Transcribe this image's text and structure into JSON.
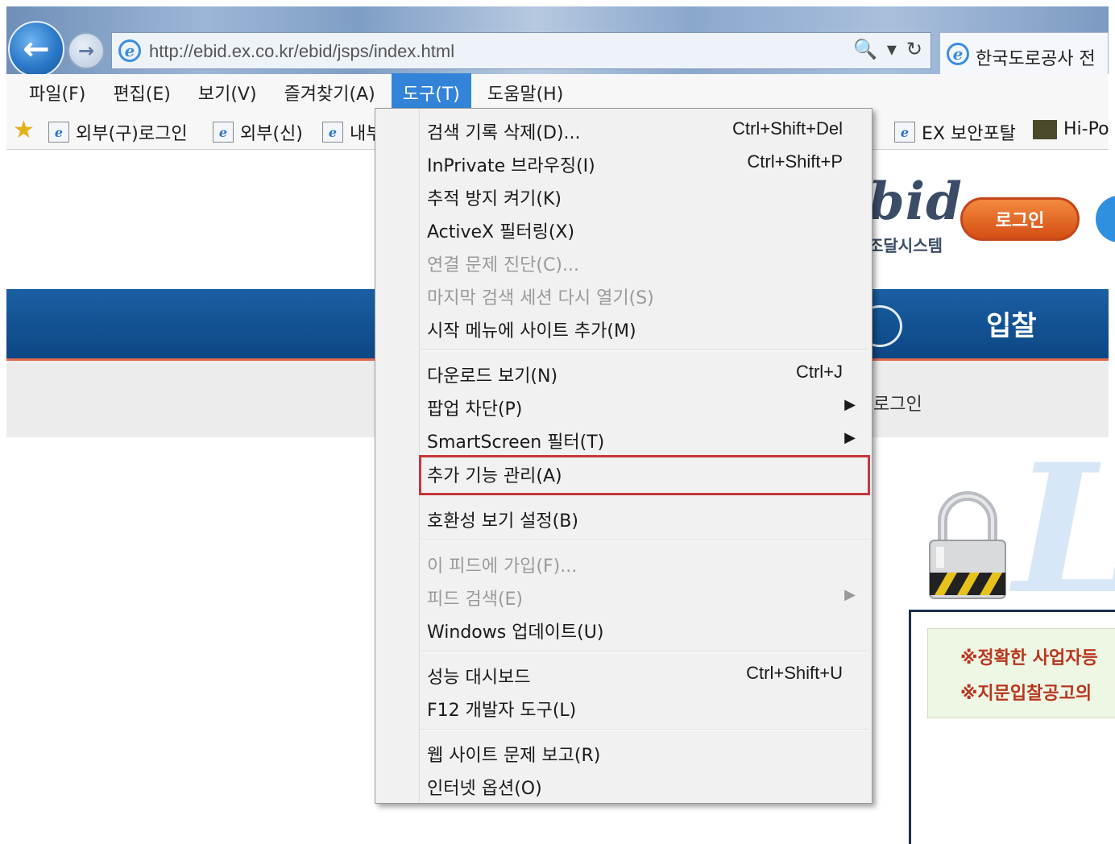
{
  "browser": {
    "url": "http://ebid.ex.co.kr/ebid/jsps/index.html",
    "tab_title": "한국도로공사 전",
    "addr_search_icon": "🔍",
    "addr_dropdown_icon": "▾",
    "addr_refresh_icon": "↻"
  },
  "menubar": {
    "items": [
      "파일(F)",
      "편집(E)",
      "보기(V)",
      "즐겨찾기(A)",
      "도구(T)",
      "도움말(H)"
    ],
    "active": "도구(T)"
  },
  "favorites": {
    "items": [
      "외부(구)로그인",
      "외부(신)",
      "내부",
      "EX 보안포탈",
      "Hi-Po"
    ]
  },
  "page": {
    "logo_text": "bid",
    "logo_subtitle": "조달시스템",
    "login_label": "로그인",
    "nav_label": "입찰",
    "subnav_label": "로그인",
    "big_letter": "L",
    "notice_lines": [
      "※정확한 사업자등",
      "※지문입찰공고의"
    ]
  },
  "tools_menu": {
    "items": [
      {
        "label": "검색 기록 삭제(D)...",
        "shortcut": "Ctrl+Shift+Del",
        "disabled": false
      },
      {
        "label": "InPrivate 브라우징(I)",
        "shortcut": "Ctrl+Shift+P",
        "disabled": false
      },
      {
        "label": "추적 방지 켜기(K)",
        "shortcut": "",
        "disabled": false
      },
      {
        "label": "ActiveX 필터링(X)",
        "shortcut": "",
        "disabled": false
      },
      {
        "label": "연결 문제 진단(C)...",
        "shortcut": "",
        "disabled": true
      },
      {
        "label": "마지막 검색 세션 다시 열기(S)",
        "shortcut": "",
        "disabled": true
      },
      {
        "label": "시작 메뉴에 사이트 추가(M)",
        "shortcut": "",
        "disabled": false
      },
      {
        "label": "다운로드 보기(N)",
        "shortcut": "Ctrl+J",
        "disabled": false
      },
      {
        "label": "팝업 차단(P)",
        "shortcut": "",
        "disabled": false,
        "submenu": true
      },
      {
        "label": "SmartScreen 필터(T)",
        "shortcut": "",
        "disabled": false,
        "submenu": true
      },
      {
        "label": "추가 기능 관리(A)",
        "shortcut": "",
        "disabled": false,
        "highlighted": true
      },
      {
        "label": "호환성 보기 설정(B)",
        "shortcut": "",
        "disabled": false
      },
      {
        "label": "이 피드에 가입(F)...",
        "shortcut": "",
        "disabled": true
      },
      {
        "label": "피드 검색(E)",
        "shortcut": "",
        "disabled": true,
        "submenu": true
      },
      {
        "label": "Windows 업데이트(U)",
        "shortcut": "",
        "disabled": false
      },
      {
        "label": "성능 대시보드",
        "shortcut": "Ctrl+Shift+U",
        "disabled": false
      },
      {
        "label": "F12 개발자 도구(L)",
        "shortcut": "",
        "disabled": false
      },
      {
        "label": "웹 사이트 문제 보고(R)",
        "shortcut": "",
        "disabled": false
      },
      {
        "label": "인터넷 옵션(O)",
        "shortcut": "",
        "disabled": false
      }
    ],
    "highlight_color": "#c8373a"
  },
  "colors": {
    "menu_active": "#3384d8",
    "nav_blue": "#0d4784",
    "login_orange": "#e0621f",
    "notice_red": "#b8361e"
  }
}
